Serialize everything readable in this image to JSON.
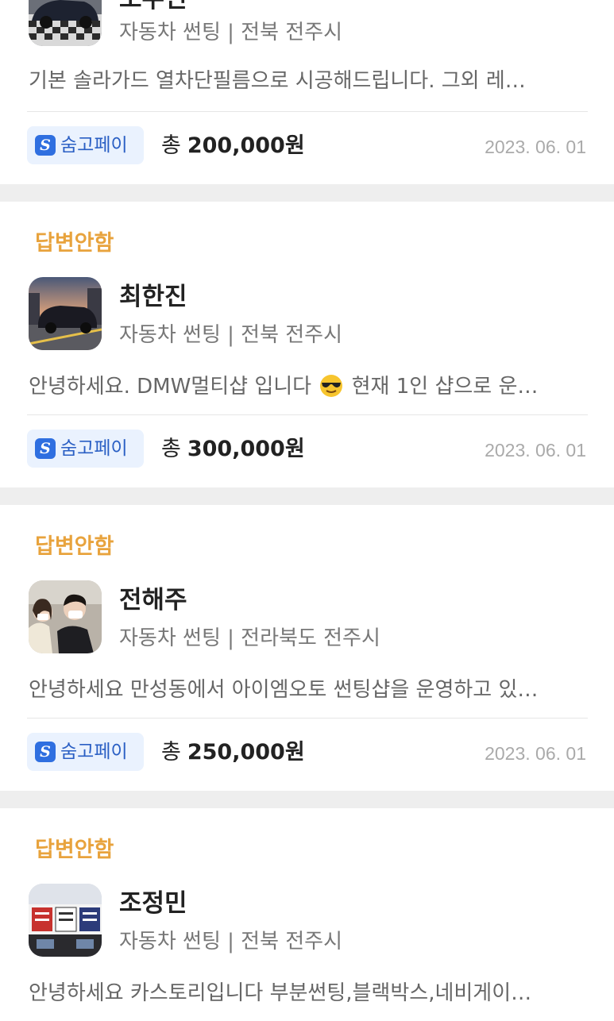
{
  "cards": [
    {
      "status": "",
      "name": "오수민",
      "category": "자동차 썬팅 | 전북 전주시",
      "description": "기본 솔라가드 열차단필름으로 시공해드립니다. 그외 레…",
      "pay_label": "숨고페이",
      "price_prefix": "총",
      "price": "200,000원",
      "date": "2023. 06. 01"
    },
    {
      "status": "답변안함",
      "name": "최한진",
      "category": "자동차 썬팅 | 전북 전주시",
      "description_before": "안녕하세요. DMW멀티샵 입니다",
      "description_after": "현재 1인 샵으로 운…",
      "pay_label": "숨고페이",
      "price_prefix": "총",
      "price": "300,000원",
      "date": "2023. 06. 01"
    },
    {
      "status": "답변안함",
      "name": "전해주",
      "category": "자동차 썬팅 | 전라북도 전주시",
      "description": "안녕하세요 만성동에서 아이엠오토 썬팅샵을 운영하고 있…",
      "pay_label": "숨고페이",
      "price_prefix": "총",
      "price": "250,000원",
      "date": "2023. 06. 01"
    },
    {
      "status": "답변안함",
      "name": "조정민",
      "category": "자동차 썬팅 | 전북 전주시",
      "description": "안녕하세요 카스토리입니다 부분썬팅,블랙박스,네비게이…"
    }
  ],
  "icons": {
    "pay": "soomgo-pay-icon",
    "emoji": "sunglasses-emoji"
  },
  "colors": {
    "status": "#e8a33d",
    "pay_badge_bg": "#eaf2fe",
    "pay_icon": "#2f6fe0"
  }
}
